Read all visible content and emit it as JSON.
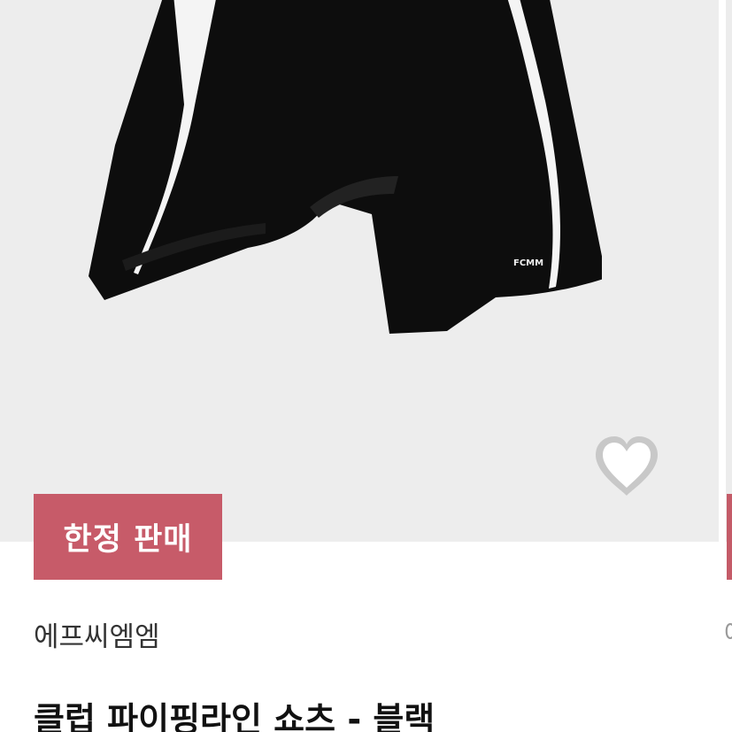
{
  "product": {
    "badge_label": "한정 판매",
    "brand": "에프씨엠엠",
    "title": "클럽 파이핑라인 쇼츠 - 블랙",
    "image_logo_text": "FCMM"
  },
  "actions": {
    "wishlist_icon": "heart-icon"
  },
  "colors": {
    "image_background": "#ededed",
    "badge_background": "#c75b69",
    "badge_text": "#ffffff",
    "heart_fill": "#ffffff",
    "heart_outline": "#c8c8c8"
  }
}
